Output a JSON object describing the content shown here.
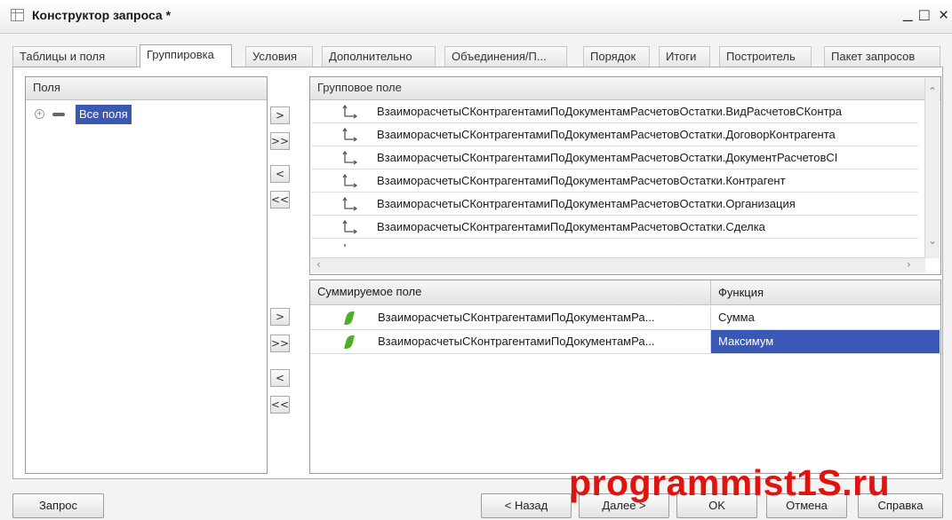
{
  "window": {
    "title": "Конструктор запроса *",
    "controls": {
      "minimize": "_",
      "maximize": "□",
      "close": "×"
    }
  },
  "tabs": [
    {
      "label": "Таблицы и поля",
      "active": false
    },
    {
      "label": "Группировка",
      "active": true
    },
    {
      "label": "Условия",
      "active": false
    },
    {
      "label": "Дополнительно",
      "active": false
    },
    {
      "label": "Объединения/П...",
      "active": false
    },
    {
      "label": "Порядок",
      "active": false
    },
    {
      "label": "Итоги",
      "active": false
    },
    {
      "label": "Построитель",
      "active": false
    },
    {
      "label": "Пакет запросов",
      "active": false
    }
  ],
  "fields_panel": {
    "header": "Поля",
    "tree": [
      {
        "label": "Все поля",
        "selected": true,
        "icon": "minus-icon"
      }
    ]
  },
  "move_buttons": {
    "right_one": ">",
    "right_all": ">>",
    "left_one": "<",
    "left_all": "<<"
  },
  "group_fields": {
    "header": "Групповое поле",
    "rows": [
      "ВзаиморасчетыСКонтрагентамиПоДокументамРасчетовОстатки.ВидРасчетовСКонтра",
      "ВзаиморасчетыСКонтрагентамиПоДокументамРасчетовОстатки.ДоговорКонтрагента",
      "ВзаиморасчетыСКонтрагентамиПоДокументамРасчетовОстатки.ДокументРасчетовСІ",
      "ВзаиморасчетыСКонтрагентамиПоДокументамРасчетовОстатки.Контрагент",
      "ВзаиморасчетыСКонтрагентамиПоДокументамРасчетовОстатки.Организация",
      "ВзаиморасчетыСКонтрагентамиПоДокументамРасчетовОстатки.Сделка"
    ],
    "row_icon": "dimension-icon"
  },
  "summary_fields": {
    "header_field": "Суммируемое поле",
    "header_function": "Функция",
    "rows": [
      {
        "field": "ВзаиморасчетыСКонтрагентамиПоДокументамРа...",
        "function": "Сумма",
        "selected": false
      },
      {
        "field": "ВзаиморасчетыСКонтрагентамиПоДокументамРа...",
        "function": "Максимум",
        "selected": true
      }
    ],
    "row_icon": "resource-leaf-icon"
  },
  "footer": {
    "query": "Запрос",
    "back": "< Назад",
    "next": "Далее >",
    "ok": "OK",
    "cancel": "Отмена",
    "help": "Справка"
  },
  "watermark": "programmist1S.ru",
  "colors": {
    "selection": "#3a58b5",
    "watermark": "#e0140f",
    "leaf": "#4fae28"
  }
}
